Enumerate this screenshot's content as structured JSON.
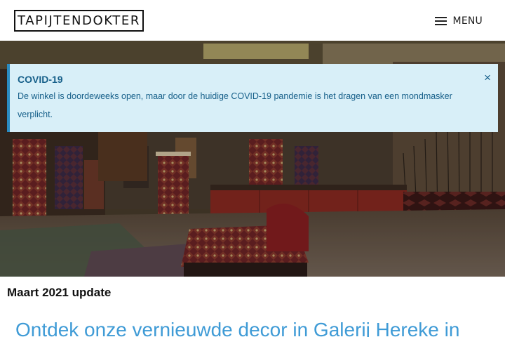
{
  "header": {
    "logo_text": "TAPIJTENDOKTER",
    "menu_label": "MENU"
  },
  "alert": {
    "title": "COVID-19",
    "body": "De winkel is doordeweeks open, maar door de huidige COVID-19 pandemie is het dragen van een mondmasker verplicht.",
    "close_symbol": "×"
  },
  "content": {
    "update_title": "Maart 2021 update",
    "headline": "Ontdek onze vernieuwde decor in Galerij Hereke in"
  },
  "colors": {
    "alert_bg": "#d8eff8",
    "alert_text": "#17608a",
    "headline": "#3f9bd6"
  },
  "icons": {
    "menu": "hamburger-icon",
    "close": "close-icon",
    "hero": "carpet-gallery-photo"
  }
}
